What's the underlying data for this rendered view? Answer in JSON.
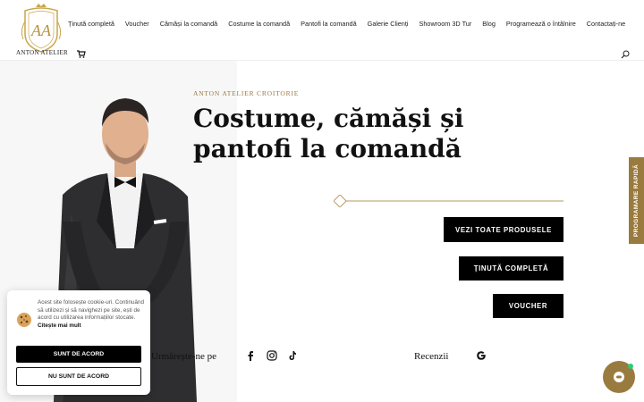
{
  "header": {
    "logo_monogram": "AA",
    "logo_text": "ANTON ATELIER",
    "nav": [
      {
        "label": "Ținută completă"
      },
      {
        "label": "Voucher"
      },
      {
        "label": "Cămăși la comandă"
      },
      {
        "label": "Costume la comandă"
      },
      {
        "label": "Pantofi la comandă"
      },
      {
        "label": "Galerie Clienți"
      },
      {
        "label": "Showroom 3D Tur"
      },
      {
        "label": "Blog"
      },
      {
        "label": "Programează o întâlnire"
      },
      {
        "label": "Contactați-ne"
      }
    ]
  },
  "hero": {
    "eyebrow": "ANTON ATELIER CROITORIE",
    "headline_line1": "Costume, cămăși și",
    "headline_line2": "pantofi la comandă",
    "buttons": {
      "products": "VEZI TOATE PRODUSELE",
      "outfit": "ȚINUTĂ COMPLETĂ",
      "voucher": "VOUCHER"
    },
    "follow_label": "Urmărește-ne pe",
    "reviews_label": "Recenzii"
  },
  "side_tab": "PROGRAMARE RAPIDĂ",
  "cookie": {
    "text": "Acest site folosește cookie-uri. Continuând să utilizezi și să navighezi pe site, ești de acord cu utilizarea informațiilor stocate.",
    "link": "Citește mai mult",
    "accept": "SUNT DE ACORD",
    "decline": "NU SUNT DE ACORD"
  },
  "colors": {
    "accent": "#9a7b3f",
    "dark": "#000000"
  }
}
